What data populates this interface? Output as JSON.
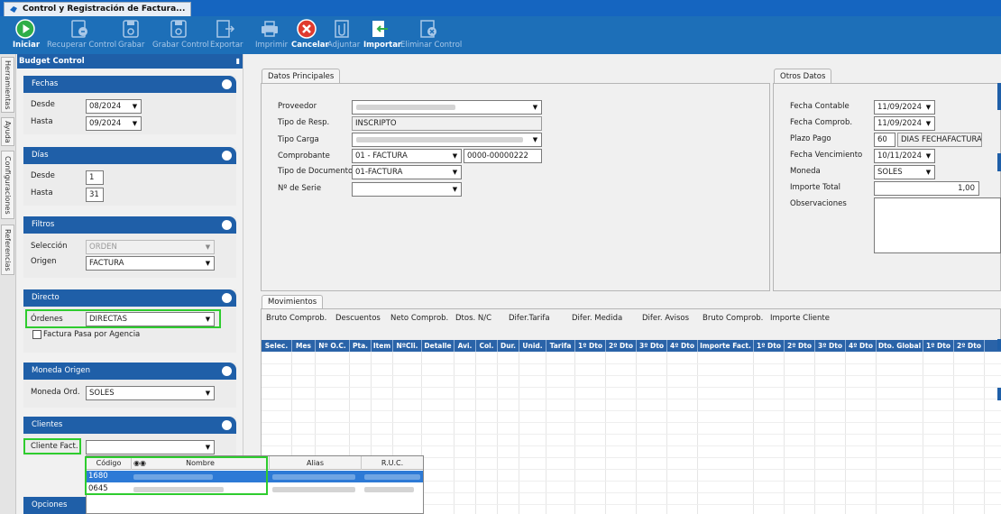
{
  "window": {
    "tab_title": "Control y Registración de Factura..."
  },
  "toolbar": [
    {
      "label": "Iniciar",
      "icon": "play-icon",
      "enabled": true
    },
    {
      "label": "Recuperar Control",
      "icon": "recover-icon",
      "enabled": false
    },
    {
      "label": "Grabar",
      "icon": "save-icon",
      "enabled": false
    },
    {
      "label": "Grabar Control",
      "icon": "save-control-icon",
      "enabled": false
    },
    {
      "label": "Exportar",
      "icon": "export-icon",
      "enabled": false
    },
    {
      "label": "Imprimir",
      "icon": "printer-icon",
      "enabled": false
    },
    {
      "label": "Cancelar",
      "icon": "cancel-icon",
      "enabled": true
    },
    {
      "label": "Adjuntar",
      "icon": "attach-icon",
      "enabled": false
    },
    {
      "label": "Importar",
      "icon": "import-icon",
      "enabled": true
    },
    {
      "label": "Eliminar Control",
      "icon": "delete-control-icon",
      "enabled": false
    }
  ],
  "sidetabs": [
    "Herramientas",
    "Ayuda",
    "Configuraciones",
    "Referencias"
  ],
  "budget": {
    "title": "Budget Control",
    "fechas": {
      "title": "Fechas",
      "desde_label": "Desde",
      "desde": "08/2024",
      "hasta_label": "Hasta",
      "hasta": "09/2024"
    },
    "dias": {
      "title": "Días",
      "desde_label": "Desde",
      "desde": "1",
      "hasta_label": "Hasta",
      "hasta": "31"
    },
    "filtros": {
      "title": "Filtros",
      "seleccion_label": "Selección",
      "seleccion": "ORDEN",
      "origen_label": "Origen",
      "origen": "FACTURA"
    },
    "directo": {
      "title": "Directo",
      "ordenes_label": "Órdenes",
      "ordenes": "DIRECTAS",
      "agencia_label": "Factura Pasa por Agencia"
    },
    "moneda": {
      "title": "Moneda Origen",
      "label": "Moneda Ord.",
      "value": "SOLES"
    },
    "clientes": {
      "title": "Clientes",
      "label": "Cliente Fact.",
      "value": ""
    },
    "opciones": {
      "title": "Opciones"
    }
  },
  "datos": {
    "title": "Datos Principales",
    "proveedor_label": "Proveedor",
    "tipo_resp_label": "Tipo de Resp.",
    "tipo_resp": "INSCRIPTO",
    "tipo_carga_label": "Tipo Carga",
    "comprobante_label": "Comprobante",
    "comprobante": "01 - FACTURA",
    "comprobante_num": "0000-00000222",
    "tipo_doc_label": "Tipo de Documento",
    "tipo_doc": "01-FACTURA",
    "serie_label": "Nº de Serie",
    "serie": ""
  },
  "otros": {
    "title": "Otros Datos",
    "fecha_contable_label": "Fecha Contable",
    "fecha_contable": "11/09/2024",
    "fecha_comprob_label": "Fecha Comprob.",
    "fecha_comprob": "11/09/2024",
    "plazo_label": "Plazo Pago",
    "plazo": "60",
    "plazo_desc": "DIAS FECHAFACTURA",
    "vencimiento_label": "Fecha Vencimiento",
    "vencimiento": "10/11/2024",
    "moneda_label": "Moneda",
    "moneda": "SOLES",
    "importe_label": "Importe Total",
    "importe": "1,00",
    "obs_label": "Observaciones"
  },
  "movimientos": {
    "title": "Movimientos",
    "summary": [
      "Bruto Comprob.",
      "Descuentos",
      "Neto Comprob.",
      "Dtos. N/C",
      "Difer.Tarifa",
      "Difer. Medida",
      "Difer. Avisos",
      "Bruto Comprob.",
      "Importe Cliente"
    ],
    "columns": [
      "Selec.",
      "Mes",
      "Nº O.C.",
      "Pta.",
      "Item",
      "NºCli.",
      "Detalle",
      "Avi.",
      "Col.",
      "Dur.",
      "Unid.",
      "Tarifa",
      "1º Dto",
      "2º Dto",
      "3º Dto",
      "4º Dto",
      "Importe Fact.",
      "1º Dto",
      "2º Dto",
      "3º Dto",
      "4º Dto",
      "Dto. Global",
      "1º Dto",
      "2º Dto"
    ]
  },
  "cliente_list": {
    "columns": [
      "Código",
      "Nombre",
      "Alias",
      "R.U.C."
    ],
    "rows": [
      {
        "codigo": "1680",
        "selected": true
      },
      {
        "codigo": "0645",
        "selected": false
      }
    ]
  },
  "colors": {
    "header_blue": "#1f5fa8",
    "highlight_green": "#2ecc2e",
    "selected_row": "#2d7ad6"
  }
}
